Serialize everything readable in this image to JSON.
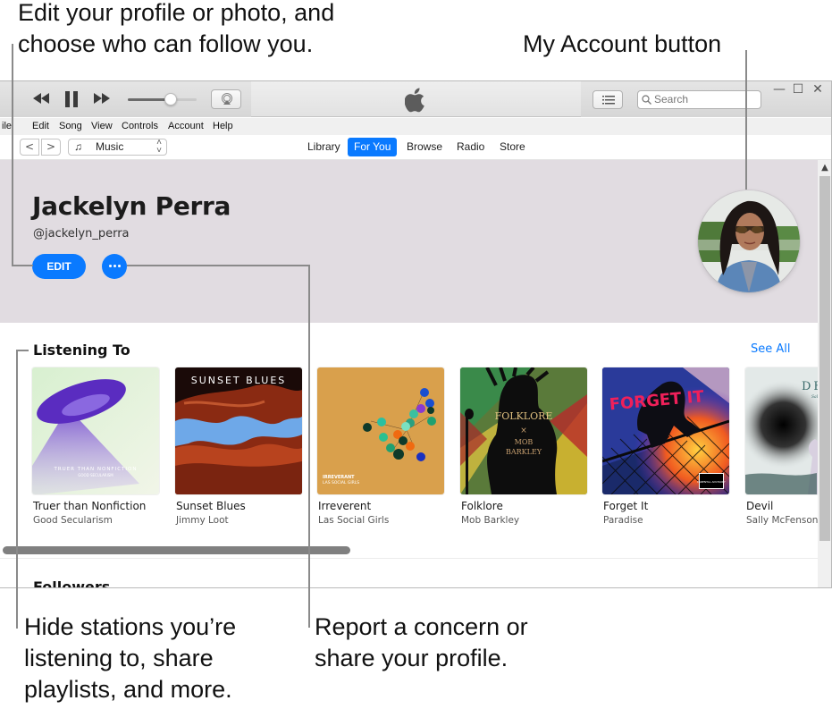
{
  "callouts": {
    "edit_profile": "Edit your profile or photo, and choose who can follow you.",
    "my_account": "My Account button",
    "hide_stations": "Hide stations you’re listening to, share playlists, and more.",
    "report_concern": "Report a concern or share your profile."
  },
  "player": {
    "volume_percent": 62,
    "icons": [
      "rewind-icon",
      "pause-icon",
      "fast-forward-icon",
      "airplay-icon"
    ]
  },
  "titlebar": {
    "search_placeholder": "Search",
    "window_controls": {
      "minimize": "—",
      "maximize": "☐",
      "close": "✕"
    }
  },
  "menubar": {
    "items": [
      "ile",
      "Edit",
      "Song",
      "View",
      "Controls",
      "Account",
      "Help"
    ]
  },
  "navbar": {
    "back": "<",
    "forward": ">",
    "media_kind": "Music",
    "tabs": [
      {
        "label": "Library",
        "active": false
      },
      {
        "label": "For You",
        "active": true
      },
      {
        "label": "Browse",
        "active": false
      },
      {
        "label": "Radio",
        "active": false
      },
      {
        "label": "Store",
        "active": false
      }
    ]
  },
  "profile": {
    "name": "Jackelyn Perra",
    "handle": "@jackelyn_perra",
    "edit_label": "EDIT",
    "more_label": "…"
  },
  "listening_to": {
    "title": "Listening To",
    "see_all": "See All",
    "albums": [
      {
        "title": "Truer than Nonfiction",
        "artist": "Good Secularism",
        "cover_text": [
          "TRUER THAN NONFICTION",
          "GOOD SECULARISM"
        ]
      },
      {
        "title": "Sunset Blues",
        "artist": "Jimmy Loot",
        "cover_text": [
          "SUNSET BLUES"
        ]
      },
      {
        "title": "Irreverent",
        "artist": "Las Social Girls",
        "cover_text": [
          "IRREVERANT",
          "LAS SOCIAL GIRLS"
        ]
      },
      {
        "title": "Folklore",
        "artist": "Mob Barkley",
        "cover_text": [
          "FOLKLORE",
          "×",
          "MOB",
          "BARKLEY"
        ]
      },
      {
        "title": "Forget It",
        "artist": "Paradise",
        "cover_text": [
          "FORGET IT",
          "PARENTAL ADVISORY"
        ]
      },
      {
        "title": "Devil",
        "artist": "Sally McFenson",
        "cover_text": [
          "DEVIL",
          "Sally McFenson"
        ]
      }
    ]
  },
  "followers": {
    "title": "Followers"
  }
}
